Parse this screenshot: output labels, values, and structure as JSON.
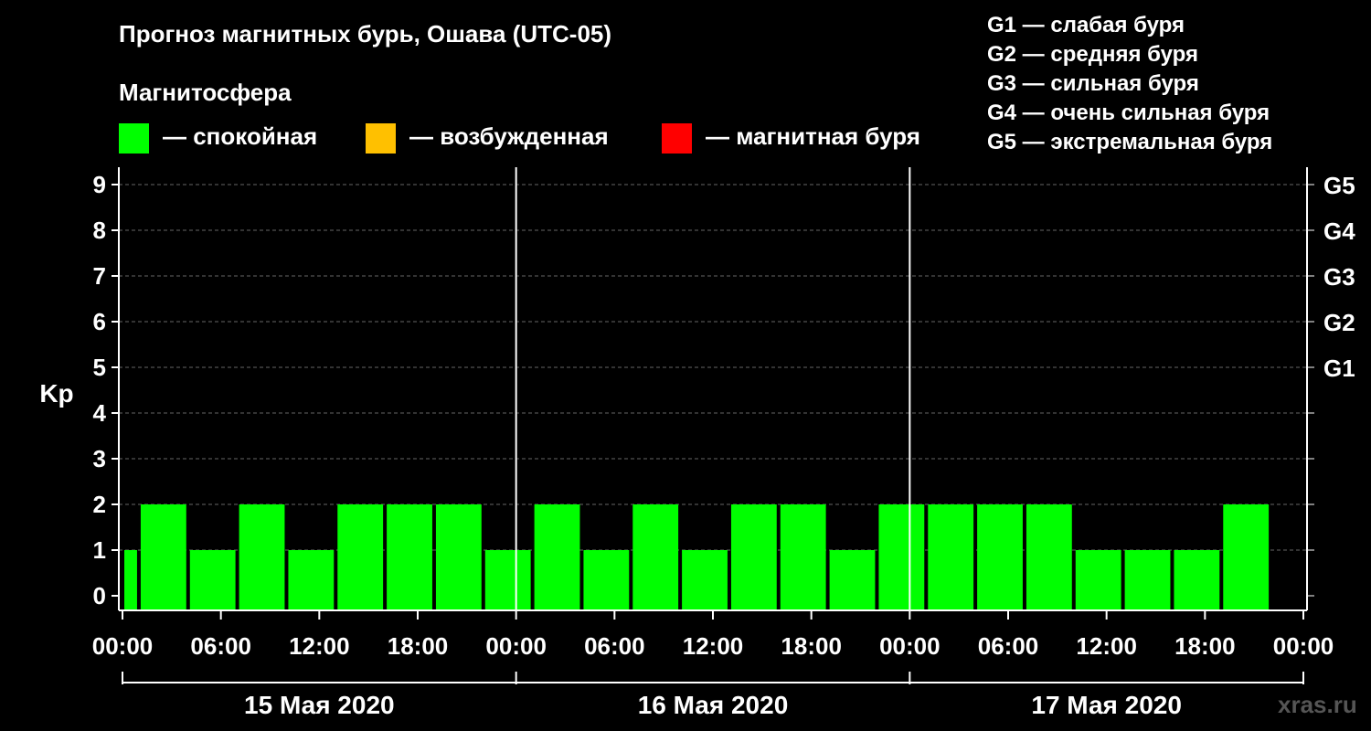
{
  "title": "Прогноз магнитных бурь, Ошава (UTC-05)",
  "magnetosphere_label": "Магнитосфера",
  "state_legend": [
    {
      "label": "— спокойная",
      "color": "#00ff00"
    },
    {
      "label": "— возбужденная",
      "color": "#ffc000"
    },
    {
      "label": "— магнитная буря",
      "color": "#ff0000"
    }
  ],
  "g_legend": [
    "G1 — слабая буря",
    "G2 — средняя буря",
    "G3 — сильная буря",
    "G4 — очень сильная буря",
    "G5 — экстремальная буря"
  ],
  "source": "xras.ru",
  "chart_data": {
    "type": "bar",
    "ylabel": "Kp",
    "ylim": [
      0,
      9
    ],
    "yticks": [
      0,
      1,
      2,
      3,
      4,
      5,
      6,
      7,
      8,
      9
    ],
    "right_ticks": [
      {
        "value": 5,
        "label": "G1"
      },
      {
        "value": 6,
        "label": "G2"
      },
      {
        "value": 7,
        "label": "G3"
      },
      {
        "value": 8,
        "label": "G4"
      },
      {
        "value": 9,
        "label": "G5"
      }
    ],
    "xlim_hours": [
      0,
      72
    ],
    "xtick_labels": [
      "00:00",
      "06:00",
      "12:00",
      "18:00",
      "00:00",
      "06:00",
      "12:00",
      "18:00",
      "00:00",
      "06:00",
      "12:00",
      "18:00",
      "00:00"
    ],
    "day_labels": [
      "15 Мая 2020",
      "16 Мая 2020",
      "17 Мая 2020"
    ],
    "bar_color": "#00ff00",
    "grid": "dashed horizontal",
    "bars": [
      {
        "start_hour": 0,
        "end_hour": 1,
        "kp": 1
      },
      {
        "start_hour": 1,
        "end_hour": 4,
        "kp": 2
      },
      {
        "start_hour": 4,
        "end_hour": 7,
        "kp": 1
      },
      {
        "start_hour": 7,
        "end_hour": 10,
        "kp": 2
      },
      {
        "start_hour": 10,
        "end_hour": 13,
        "kp": 1
      },
      {
        "start_hour": 13,
        "end_hour": 16,
        "kp": 2
      },
      {
        "start_hour": 16,
        "end_hour": 19,
        "kp": 2
      },
      {
        "start_hour": 19,
        "end_hour": 22,
        "kp": 2
      },
      {
        "start_hour": 22,
        "end_hour": 25,
        "kp": 1
      },
      {
        "start_hour": 25,
        "end_hour": 28,
        "kp": 2
      },
      {
        "start_hour": 28,
        "end_hour": 31,
        "kp": 1
      },
      {
        "start_hour": 31,
        "end_hour": 34,
        "kp": 2
      },
      {
        "start_hour": 34,
        "end_hour": 37,
        "kp": 1
      },
      {
        "start_hour": 37,
        "end_hour": 40,
        "kp": 2
      },
      {
        "start_hour": 40,
        "end_hour": 43,
        "kp": 2
      },
      {
        "start_hour": 43,
        "end_hour": 46,
        "kp": 1
      },
      {
        "start_hour": 46,
        "end_hour": 49,
        "kp": 2
      },
      {
        "start_hour": 49,
        "end_hour": 52,
        "kp": 2
      },
      {
        "start_hour": 52,
        "end_hour": 55,
        "kp": 2
      },
      {
        "start_hour": 55,
        "end_hour": 58,
        "kp": 2
      },
      {
        "start_hour": 58,
        "end_hour": 61,
        "kp": 1
      },
      {
        "start_hour": 61,
        "end_hour": 64,
        "kp": 1
      },
      {
        "start_hour": 64,
        "end_hour": 67,
        "kp": 1
      },
      {
        "start_hour": 67,
        "end_hour": 70,
        "kp": 2
      }
    ]
  }
}
